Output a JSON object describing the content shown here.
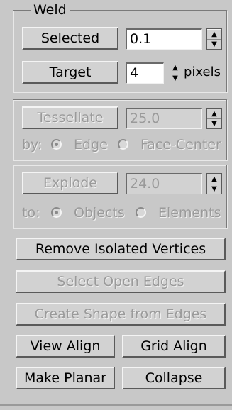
{
  "weld": {
    "title": "Weld",
    "selected_label": "Selected",
    "selected_value": "0.1",
    "target_label": "Target",
    "target_value": "4",
    "pixels_label": "pixels"
  },
  "tessellate": {
    "button_label": "Tessellate",
    "value": "25.0",
    "by_label": "by:",
    "option_edge": "Edge",
    "option_face_center": "Face-Center",
    "selected_option": "Edge"
  },
  "explode": {
    "button_label": "Explode",
    "value": "24.0",
    "to_label": "to:",
    "option_objects": "Objects",
    "option_elements": "Elements",
    "selected_option": "Objects"
  },
  "buttons": {
    "remove_isolated_vertices": "Remove Isolated Vertices",
    "select_open_edges": "Select Open Edges",
    "create_shape_from_edges": "Create Shape from Edges",
    "view_align": "View Align",
    "grid_align": "Grid Align",
    "make_planar": "Make Planar",
    "collapse": "Collapse"
  }
}
